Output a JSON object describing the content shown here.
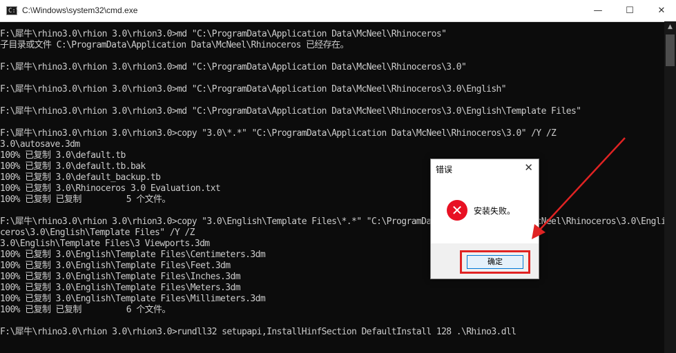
{
  "window": {
    "title": "C:\\Windows\\system32\\cmd.exe",
    "app_icon_text": "C:\\",
    "minimize_glyph": "—",
    "maximize_glyph": "☐",
    "close_glyph": "✕"
  },
  "console": {
    "lines": [
      "F:\\犀牛\\rhino3.0\\rhion 3.0\\rhion3.0>md \"C:\\ProgramData\\Application Data\\McNeel\\Rhinoceros\"",
      "子目录或文件 C:\\ProgramData\\Application Data\\McNeel\\Rhinoceros 已经存在。",
      "",
      "F:\\犀牛\\rhino3.0\\rhion 3.0\\rhion3.0>md \"C:\\ProgramData\\Application Data\\McNeel\\Rhinoceros\\3.0\"",
      "",
      "F:\\犀牛\\rhino3.0\\rhion 3.0\\rhion3.0>md \"C:\\ProgramData\\Application Data\\McNeel\\Rhinoceros\\3.0\\English\"",
      "",
      "F:\\犀牛\\rhino3.0\\rhion 3.0\\rhion3.0>md \"C:\\ProgramData\\Application Data\\McNeel\\Rhinoceros\\3.0\\English\\Template Files\"",
      "",
      "F:\\犀牛\\rhino3.0\\rhion 3.0\\rhion3.0>copy \"3.0\\*.*\" \"C:\\ProgramData\\Application Data\\McNeel\\Rhinoceros\\3.0\" /Y /Z",
      "3.0\\autosave.3dm",
      "100% 已复制 3.0\\default.tb",
      "100% 已复制 3.0\\default.tb.bak",
      "100% 已复制 3.0\\default_backup.tb",
      "100% 已复制 3.0\\Rhinoceros 3.0 Evaluation.txt",
      "100% 已复制 已复制         5 个文件。",
      "",
      "F:\\犀牛\\rhino3.0\\rhion 3.0\\rhion3.0>copy \"3.0\\English\\Template Files\\*.*\" \"C:\\ProgramData\\Application Data\\McNeel\\Rhinoceros\\3.0\\English\\Template Files\" /Y /Z",
      "ceros\\3.0\\English\\Template Files\" /Y /Z",
      "3.0\\English\\Template Files\\3 Viewports.3dm",
      "100% 已复制 3.0\\English\\Template Files\\Centimeters.3dm",
      "100% 已复制 3.0\\English\\Template Files\\Feet.3dm",
      "100% 已复制 3.0\\English\\Template Files\\Inches.3dm",
      "100% 已复制 3.0\\English\\Template Files\\Meters.3dm",
      "100% 已复制 3.0\\English\\Template Files\\Millimeters.3dm",
      "100% 已复制 已复制         6 个文件。",
      "",
      "F:\\犀牛\\rhino3.0\\rhion 3.0\\rhion3.0>rundll32 setupapi,InstallHinfSection DefaultInstall 128 .\\Rhino3.dll"
    ]
  },
  "scrollbar": {
    "up_glyph": "▲"
  },
  "dialog": {
    "title": "错误",
    "close_glyph": "✕",
    "icon": "error-icon",
    "icon_glyph": "✕",
    "message": "安装失败。",
    "ok_label": "确定"
  },
  "annotation": {
    "highlight_color": "#e02323"
  }
}
